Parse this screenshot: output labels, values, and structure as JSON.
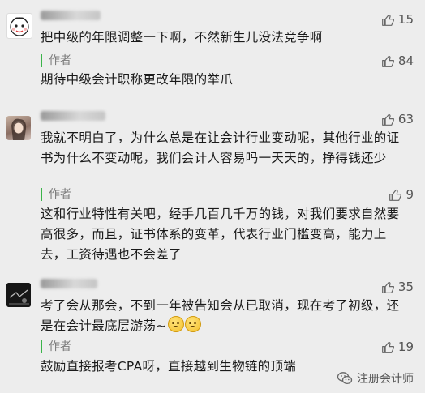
{
  "comments": [
    {
      "like_count": "15",
      "text": "把中级的年限调整一下啊，不然新生儿没法竞争啊",
      "reply": {
        "author_label": "作者",
        "like_count": "84",
        "text": "期待中级会计职称更改年限的举爪"
      }
    },
    {
      "like_count": "63",
      "text": "我就不明白了，为什么总是在让会计行业变动呢，其他行业的证书为什么不变动呢，我们会计人容易吗一天天的，挣得钱还少",
      "reply": {
        "author_label": "作者",
        "like_count": "9",
        "text": "这和行业特性有关吧，经手几百几千万的钱，对我们要求自然要高很多，而且，证书体系的变革，代表行业门槛变高，能力上去，工资待遇也不会差了"
      }
    },
    {
      "like_count": "35",
      "text": "考了会从那会，不到一年被告知会从已取消，现在考了初级，还是在会计最底层游荡~",
      "reply": {
        "author_label": "作者",
        "like_count": "19",
        "text": "鼓励直接报考CPA呀，直接越到生物链的顶端"
      }
    }
  ],
  "watermark": {
    "text": "注册会计师",
    "icon": "wechat-icon"
  }
}
